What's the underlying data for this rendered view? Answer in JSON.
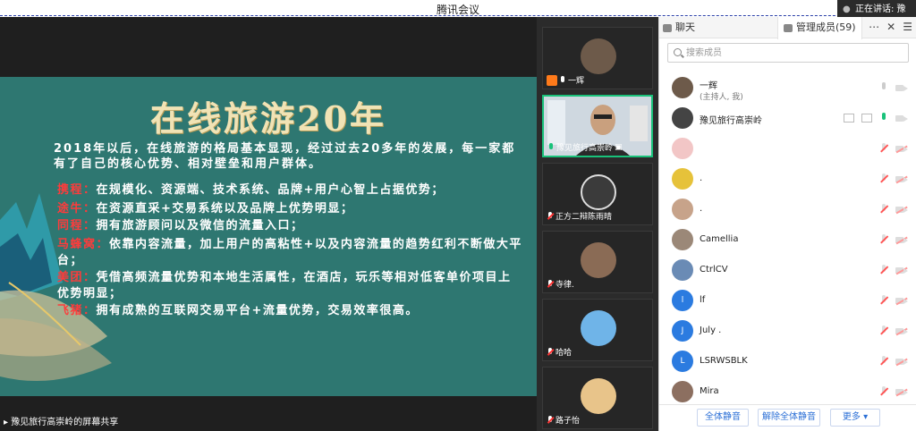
{
  "window": {
    "title": "腾讯会议"
  },
  "speaking": {
    "text": "正在讲话: 豫"
  },
  "slide": {
    "title": "在线旅游20年",
    "intro": "2018年以后，在线旅游的格局基本显现，经过过去20多年的发展，每一家都有了自己的核心优势、相对壁垒和用户群体。",
    "items": [
      {
        "key": "携程：",
        "text": "在规模化、资源端、技术系统、品牌+用户心智上占据优势；"
      },
      {
        "key": "途牛：",
        "text": "在资源直采+交易系统以及品牌上优势明显；"
      },
      {
        "key": "同程：",
        "text": "拥有旅游顾问以及微信的流量入口；"
      },
      {
        "key": "马蜂窝：",
        "text": "依靠内容流量，加上用户的高粘性+以及内容流量的趋势红利不断做大平台；"
      },
      {
        "key": "美团：",
        "text": "凭借高频流量优势和本地生活属性，在酒店，玩乐等相对低客单价项目上优势明显；"
      },
      {
        "key": "飞猪：",
        "text": "拥有成熟的互联网交易平台+流量优势，交易效率很高。"
      }
    ]
  },
  "share_label": "豫见旅行高崇岭的屏幕共享",
  "videos": [
    {
      "name": "一辉"
    },
    {
      "name": "豫见旅行高崇岭"
    },
    {
      "name": "正方二辩陈雨晴"
    },
    {
      "name": "寺律."
    },
    {
      "name": "哈哈"
    },
    {
      "name": "路子怡"
    }
  ],
  "panel": {
    "tab_chat": "聊天",
    "tab_members": "管理成员(59)",
    "search_placeholder": "搜索成员",
    "members": [
      {
        "name": "一辉",
        "sub": "(主持人, 我)"
      },
      {
        "name": "豫见旅行高崇岭"
      },
      {
        "name": ""
      },
      {
        "name": "."
      },
      {
        "name": "."
      },
      {
        "name": "Camellia"
      },
      {
        "name": "CtrlCV"
      },
      {
        "name": "lf",
        "initial": "l"
      },
      {
        "name": "July .",
        "initial": "J"
      },
      {
        "name": "LSRWSBLK",
        "initial": "L"
      },
      {
        "name": "Mira"
      }
    ],
    "buttons": {
      "mute_all": "全体静音",
      "unmute_all": "解除全体静音",
      "more": "更多 ▾"
    }
  },
  "colors": {
    "slide_bg": "#2e7771",
    "slide_title": "#f1e3b5",
    "accent_blue": "#2b6fd6",
    "active_green": "#19c27a"
  }
}
